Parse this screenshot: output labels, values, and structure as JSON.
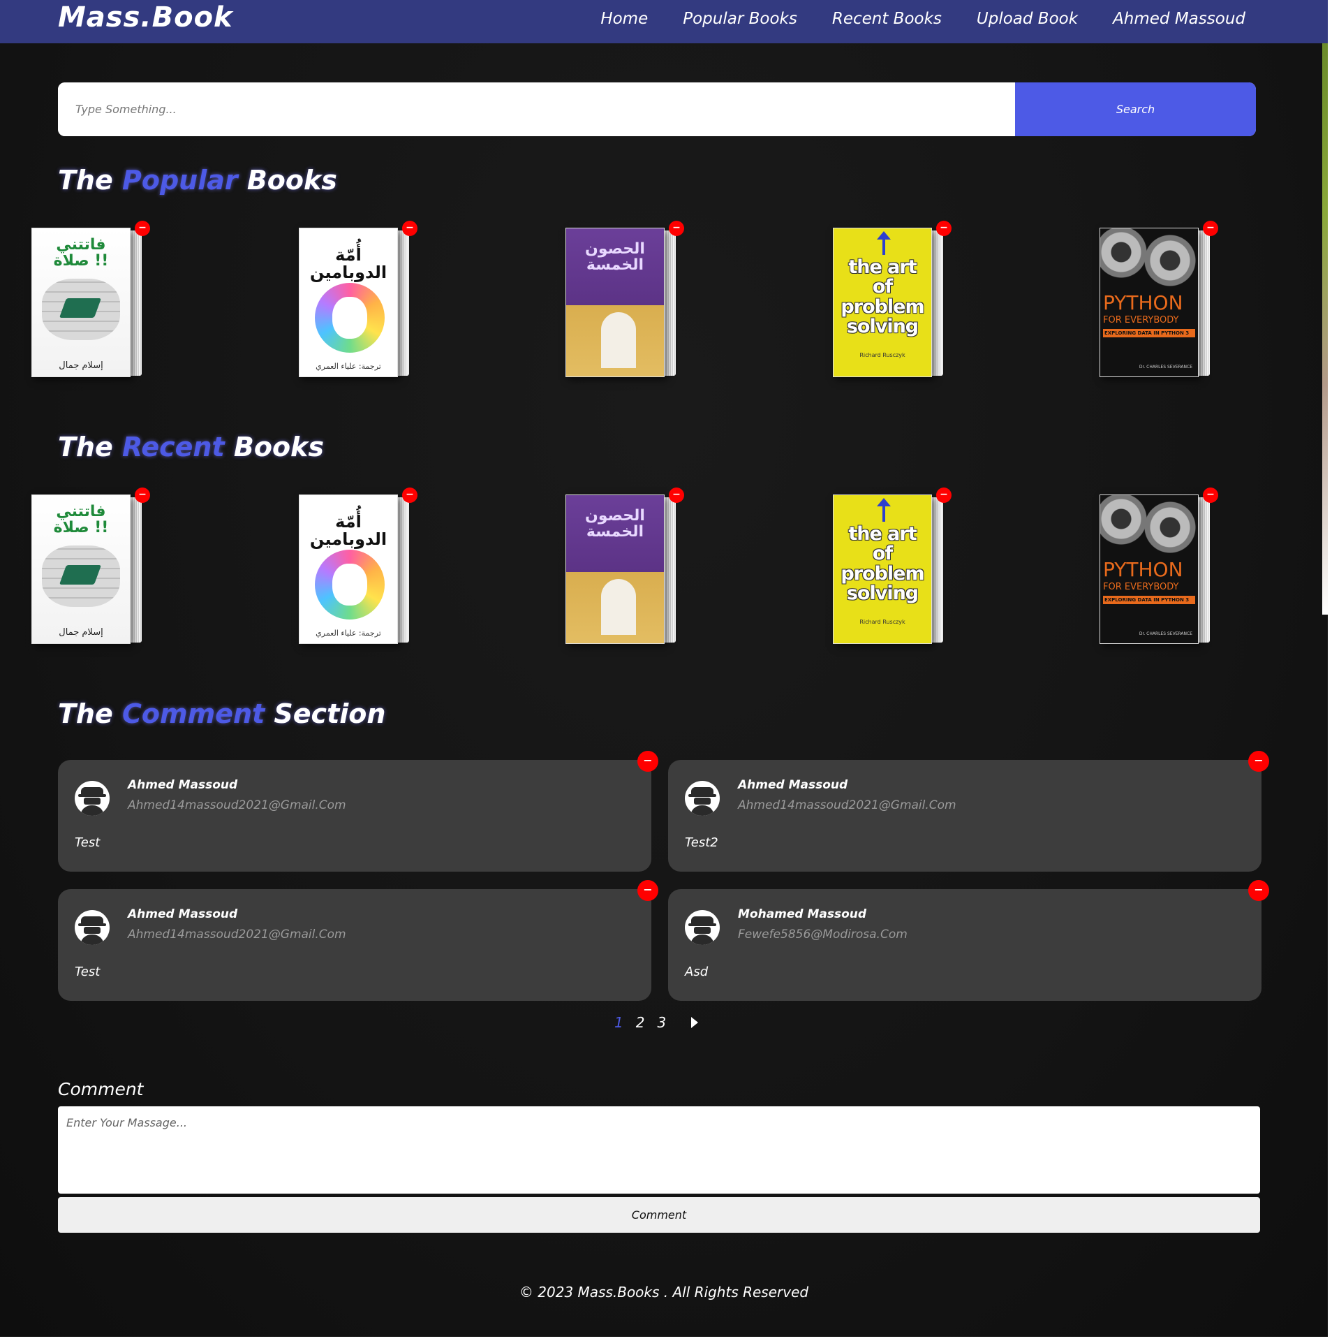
{
  "navbar": {
    "logo": "Mass.Book",
    "links": [
      "Home",
      "Popular Books",
      "Recent Books",
      "Upload Book",
      "Ahmed Massoud"
    ],
    "background": "#333a80"
  },
  "search": {
    "placeholder": "Type Something...",
    "button_label": "Search"
  },
  "popular": {
    "title_parts": [
      "The",
      "Popular",
      "Books"
    ]
  },
  "recent": {
    "title_parts": [
      "The",
      "Recent",
      "Books"
    ]
  },
  "books": [
    {
      "cover_title": "فاتتني صلاة !!",
      "author": "إسلام جمال"
    },
    {
      "cover_title": "أُمّة الدوبامين",
      "author": "ترجمة: علياء العمري"
    },
    {
      "cover_title": "الحصون الخمسة"
    },
    {
      "cover_title": "the art of problem solving",
      "author": "Richard Rusczyk"
    },
    {
      "cover_title": "PYTHON",
      "subtitle": "FOR EVERYBODY",
      "band": "EXPLORING DATA IN PYTHON 3",
      "author": "Dr. CHARLES SEVERANCE"
    }
  ],
  "delete_symbol": "−",
  "comments_section": {
    "title_parts": [
      "The",
      "Comment",
      "Section"
    ],
    "comments": [
      {
        "name": "Ahmed Massoud",
        "email": "Ahmed14massoud2021@Gmail.Com",
        "text": "Test"
      },
      {
        "name": "Ahmed Massoud",
        "email": "Ahmed14massoud2021@Gmail.Com",
        "text": "Test2"
      },
      {
        "name": "Ahmed Massoud",
        "email": "Ahmed14massoud2021@Gmail.Com",
        "text": "Test"
      },
      {
        "name": "Mohamed Massoud",
        "email": "Fewefe5856@Modirosa.Com",
        "text": "Asd"
      }
    ]
  },
  "pagination": {
    "pages": [
      "1",
      "2",
      "3"
    ],
    "current": "1",
    "next_icon": "play-arrow-icon"
  },
  "comment_form": {
    "label": "Comment",
    "placeholder": "Enter Your Massage...",
    "button_label": "Comment"
  },
  "footer": {
    "text": "© 2023 Mass.Books . All Rights Reserved"
  },
  "colors": {
    "accent": "#4d5ae6",
    "delete_badge": "#ff0000",
    "card_bg": "#3d3d3d"
  }
}
